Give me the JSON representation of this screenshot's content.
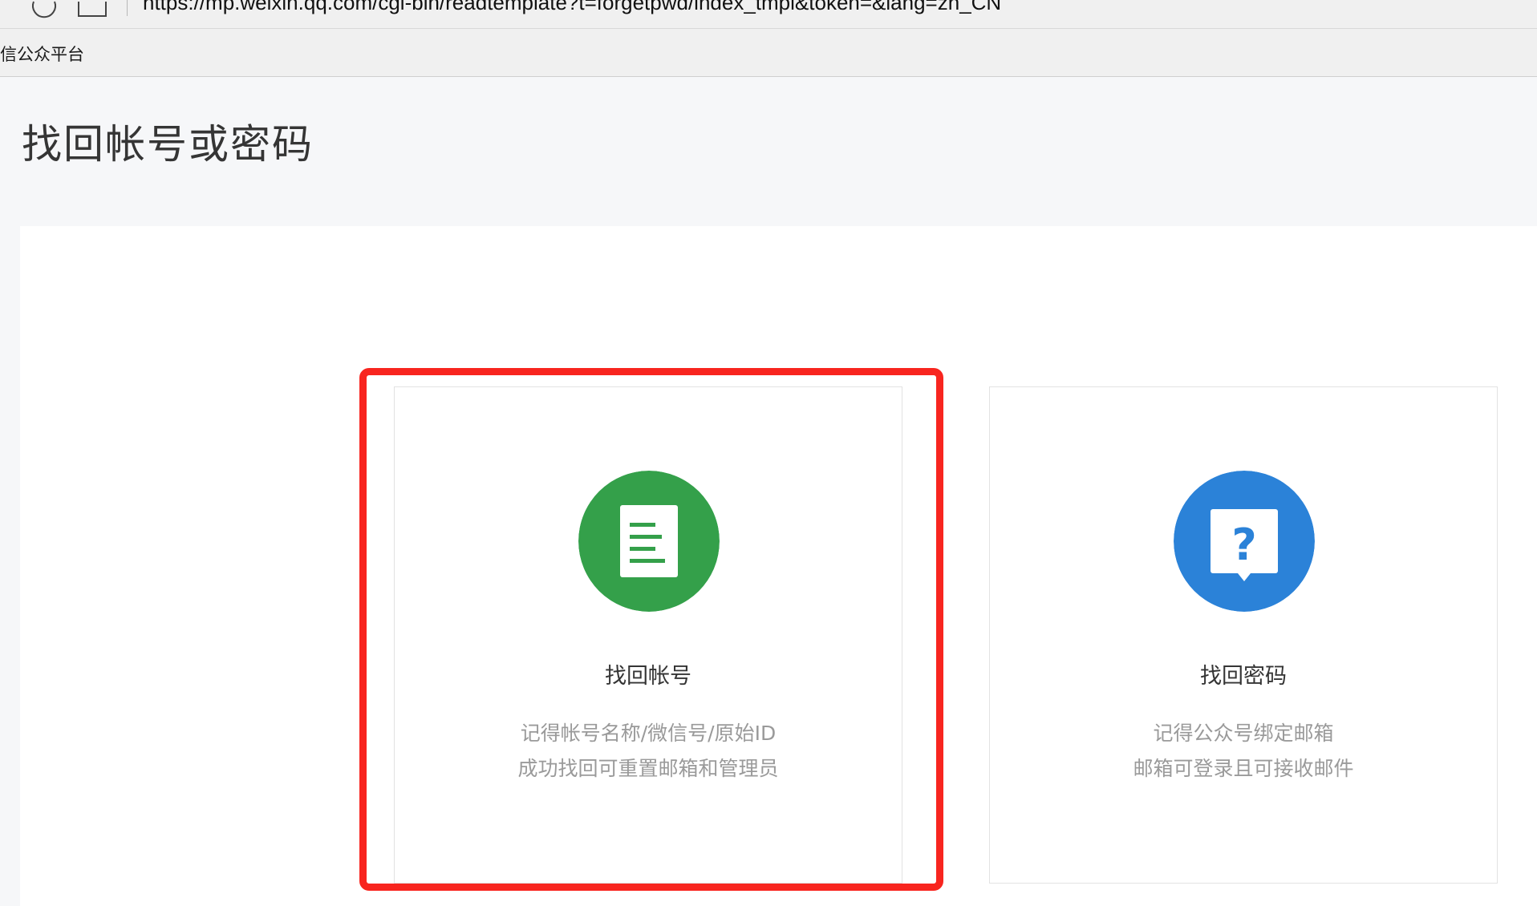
{
  "browser": {
    "url": "https://mp.weixin.qq.com/cgi-bin/readtemplate?t=forgetpwd/index_tmpl&token=&lang=zh_CN",
    "tab_title": "信公众平台"
  },
  "page": {
    "title": "找回帐号或密码"
  },
  "options": [
    {
      "title": "找回帐号",
      "desc_line1": "记得帐号名称/微信号/原始ID",
      "desc_line2": "成功找回可重置邮箱和管理员",
      "icon": "document-icon",
      "icon_color": "#34a04a"
    },
    {
      "title": "找回密码",
      "desc_line1": "记得公众号绑定邮箱",
      "desc_line2": "邮箱可登录且可接收邮件",
      "icon": "question-bubble-icon",
      "icon_color": "#2b82d8"
    }
  ],
  "colors": {
    "highlight": "#f8251f",
    "background": "#f6f7f9"
  }
}
